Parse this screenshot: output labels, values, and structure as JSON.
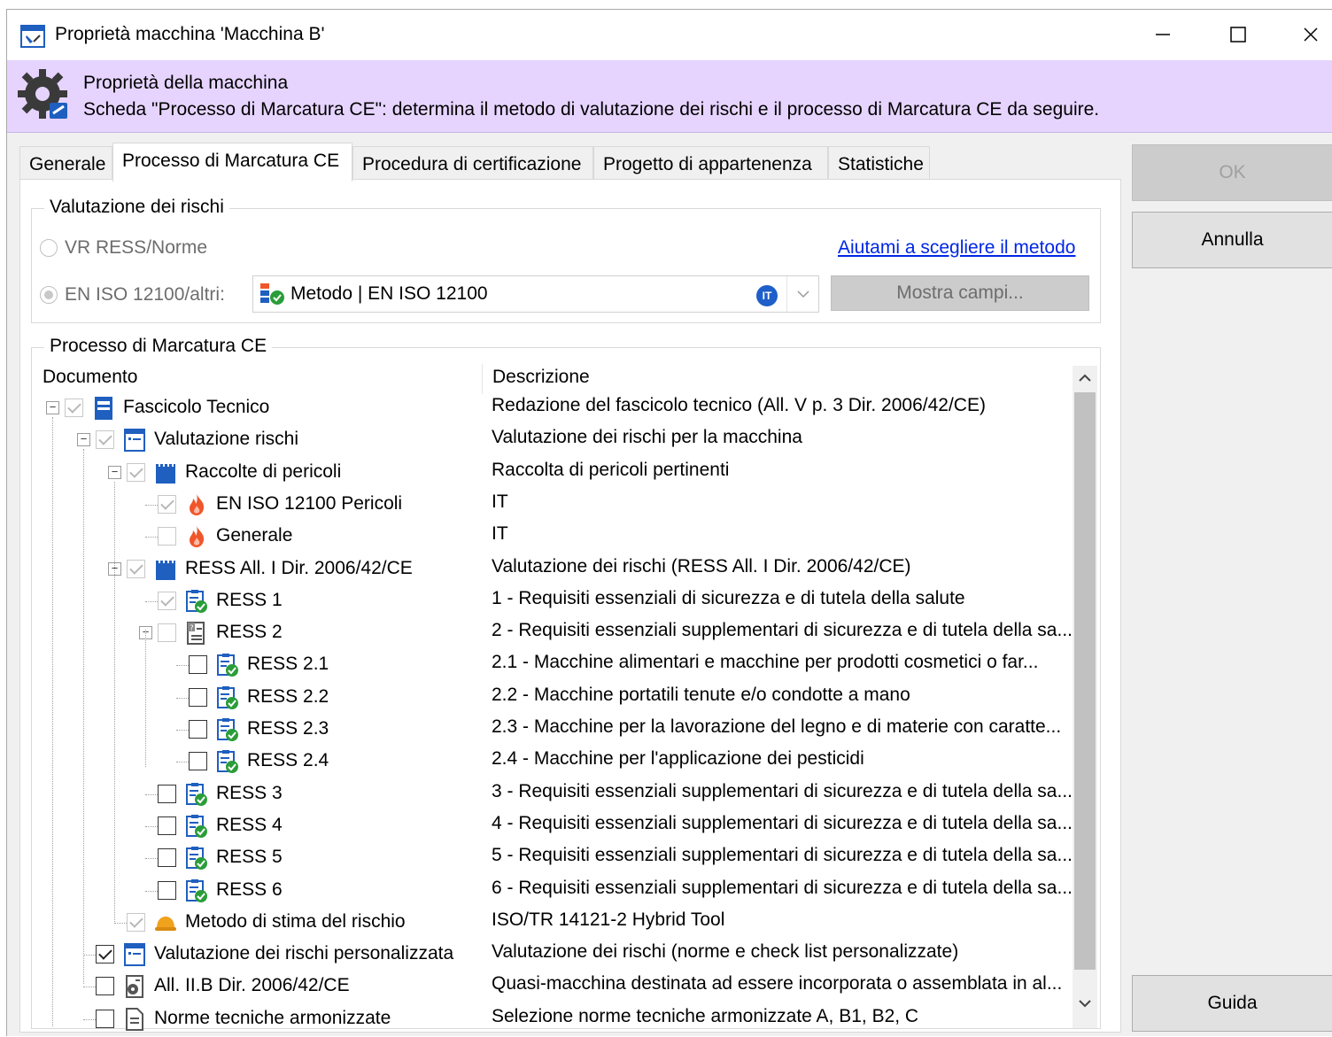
{
  "window": {
    "title": "Proprietà macchina 'Macchina B'",
    "minimize_glyph": "─",
    "maximize_glyph": "☐",
    "close_glyph": "✕"
  },
  "header": {
    "title": "Proprietà della macchina",
    "subtitle": "Scheda \"Processo di Marcatura CE\": determina il metodo di valutazione dei rischi e il processo di Marcatura CE da seguire."
  },
  "tabs": [
    {
      "label": "Generale"
    },
    {
      "label": "Processo di Marcatura CE",
      "active": true
    },
    {
      "label": "Procedura di certificazione"
    },
    {
      "label": "Progetto di appartenenza"
    },
    {
      "label": "Statistiche"
    }
  ],
  "risk_group": {
    "legend": "Valutazione dei rischi",
    "radio_vr": "VR RESS/Norme",
    "radio_iso": "EN ISO 12100/altri:",
    "help_link": "Aiutami a scegliere il metodo",
    "method_value": "Metodo | EN ISO 12100",
    "method_badge": "IT",
    "show_fields": "Mostra campi..."
  },
  "process_group": {
    "legend": "Processo di Marcatura CE",
    "col_document": "Documento",
    "col_description": "Descrizione"
  },
  "tree": [
    {
      "label": "Fascicolo Tecnico",
      "desc": "Redazione del fascicolo tecnico (All. V p. 3 Dir. 2006/42/CE)",
      "icon": "book-icon"
    },
    {
      "label": "Valutazione rischi",
      "desc": "Valutazione dei rischi per la macchina",
      "icon": "form-icon"
    },
    {
      "label": "Raccolte di pericoli",
      "desc": "Raccolta di pericoli pertinenti",
      "icon": "binder-icon"
    },
    {
      "label": "EN ISO 12100 Pericoli",
      "desc": "IT",
      "icon": "flame-icon"
    },
    {
      "label": "Generale",
      "desc": "IT",
      "icon": "flame-icon"
    },
    {
      "label": "RESS All. I Dir. 2006/42/CE",
      "desc": "Valutazione dei rischi (RESS All. I Dir. 2006/42/CE)",
      "icon": "binder-icon"
    },
    {
      "label": "RESS 1",
      "desc": "1 - Requisiti essenziali di sicurezza e di tutela della salute",
      "icon": "checklist-icon"
    },
    {
      "label": "RESS 2",
      "desc": "2 - Requisiti essenziali supplementari di sicurezza e di tutela della sa...",
      "icon": "doc-question-icon"
    },
    {
      "label": "RESS 2.1",
      "desc": "2.1 - Macchine alimentari e macchine per prodotti cosmetici o far...",
      "icon": "checklist-icon"
    },
    {
      "label": "RESS 2.2",
      "desc": "2.2 - Macchine portatili tenute e/o condotte a mano",
      "icon": "checklist-icon"
    },
    {
      "label": "RESS 2.3",
      "desc": "2.3 - Macchine per la lavorazione del legno e di materie con caratte...",
      "icon": "checklist-icon"
    },
    {
      "label": "RESS 2.4",
      "desc": "2.4 - Macchine per l'applicazione dei pesticidi",
      "icon": "checklist-icon"
    },
    {
      "label": "RESS 3",
      "desc": "3 - Requisiti essenziali supplementari di sicurezza e di tutela della sa...",
      "icon": "checklist-icon"
    },
    {
      "label": "RESS 4",
      "desc": "4 - Requisiti essenziali supplementari di sicurezza e di tutela della sa...",
      "icon": "checklist-icon"
    },
    {
      "label": "RESS 5",
      "desc": "5 - Requisiti essenziali supplementari di sicurezza e di tutela della sa...",
      "icon": "checklist-icon"
    },
    {
      "label": "RESS 6",
      "desc": "6 - Requisiti essenziali supplementari di sicurezza e di tutela della sa...",
      "icon": "checklist-icon"
    },
    {
      "label": "Metodo di stima del rischio",
      "desc": "ISO/TR 14121-2 Hybrid Tool",
      "icon": "hardhat-icon"
    },
    {
      "label": "Valutazione dei rischi personalizzata",
      "desc": "Valutazione dei rischi (norme e check list personalizzate)",
      "icon": "form-icon"
    },
    {
      "label": "All. II.B Dir. 2006/42/CE",
      "desc": "Quasi-macchina destinata ad essere incorporata o assemblata in al...",
      "icon": "doc-gear-icon"
    },
    {
      "label": "Norme tecniche armonizzate",
      "desc": "Selezione norme tecniche armonizzate A, B1, B2, C",
      "icon": "doc-icon"
    }
  ],
  "buttons": {
    "ok": "OK",
    "cancel": "Annulla",
    "help": "Guida"
  },
  "colors": {
    "header_band": "#e6d4ff",
    "link": "#0026e6",
    "icon_blue": "#1f5fbf",
    "icon_green": "#2a9d3a",
    "flame": "#f0562a"
  }
}
